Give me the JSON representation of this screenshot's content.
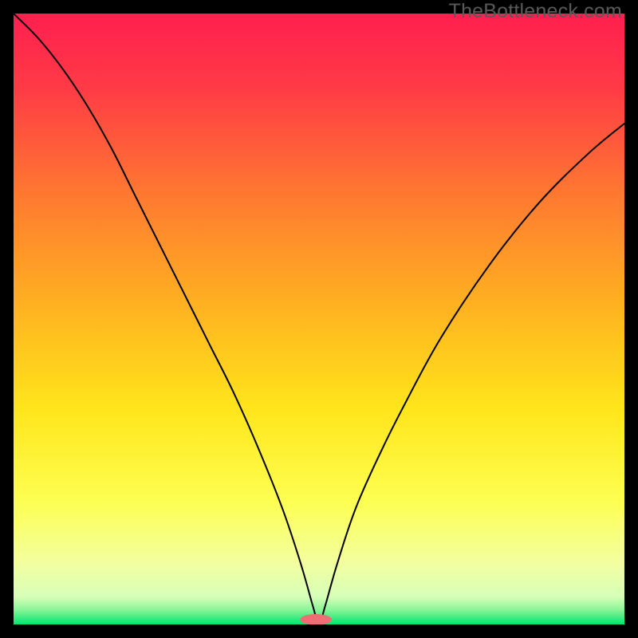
{
  "watermark": "TheBottleneck.com",
  "chart_data": {
    "type": "line",
    "title": "",
    "xlabel": "",
    "ylabel": "",
    "xlim": [
      0,
      100
    ],
    "ylim": [
      0,
      100
    ],
    "grid": false,
    "legend": false,
    "background": {
      "kind": "vertical-gradient",
      "description": "top=red, mid=yellow, bottom thin green band",
      "stops": [
        {
          "offset": 0.0,
          "color": "#ff1f4f"
        },
        {
          "offset": 0.12,
          "color": "#ff3a46"
        },
        {
          "offset": 0.3,
          "color": "#ff7a30"
        },
        {
          "offset": 0.5,
          "color": "#ffb81f"
        },
        {
          "offset": 0.65,
          "color": "#ffe61b"
        },
        {
          "offset": 0.8,
          "color": "#fdff52"
        },
        {
          "offset": 0.9,
          "color": "#f3ffa0"
        },
        {
          "offset": 0.955,
          "color": "#d6ffb8"
        },
        {
          "offset": 0.975,
          "color": "#8ef59a"
        },
        {
          "offset": 1.0,
          "color": "#00e66b"
        }
      ]
    },
    "series": [
      {
        "name": "bottleneck-curve",
        "stroke": "#000000",
        "stroke_width": 2,
        "x": [
          0,
          4,
          8,
          12,
          16,
          20,
          24,
          28,
          32,
          36,
          40,
          44,
          47,
          49,
          50,
          51,
          53,
          56,
          60,
          64,
          70,
          78,
          86,
          94,
          100
        ],
        "y": [
          100,
          96,
          91,
          85,
          78,
          70,
          62,
          54,
          46,
          38,
          29,
          19,
          10,
          3,
          0,
          3,
          10,
          19,
          28,
          36,
          47,
          59,
          69,
          77,
          82
        ],
        "note": "Approximate V-shaped bottleneck curve. y=0 is the green band at the bottom; y=100 is the top. Minimum at x≈50."
      }
    ],
    "marker": {
      "name": "optimum-marker",
      "shape": "pill",
      "color": "#ef6e73",
      "cx": 49.5,
      "cy": 0.8,
      "rx": 2.6,
      "ry": 0.9,
      "note": "Small salmon pill capsule sitting on the green band at the curve minimum."
    }
  }
}
